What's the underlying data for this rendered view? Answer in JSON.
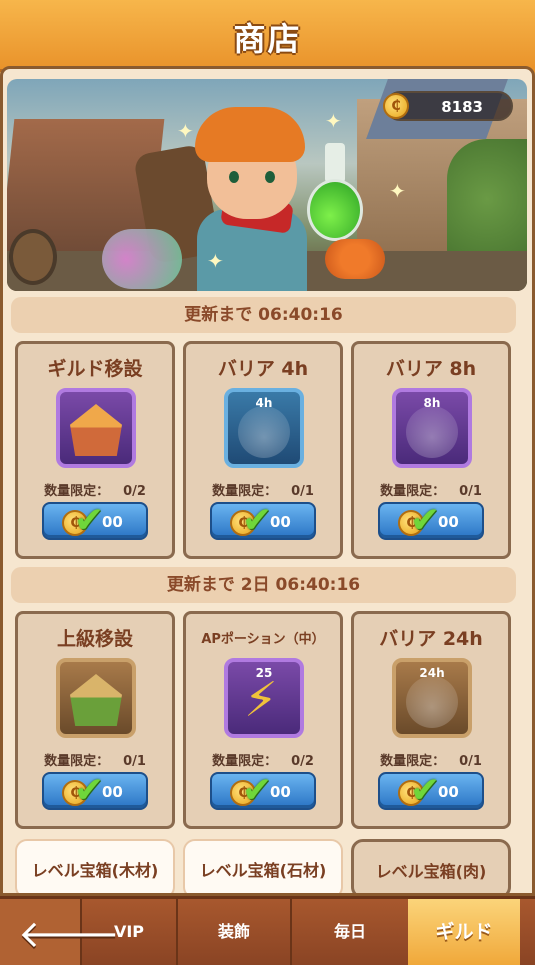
{
  "header": {
    "title": "商店"
  },
  "currency": {
    "icon": "coin-icon",
    "value": "8183"
  },
  "sections": [
    {
      "label": "更新まで 06:40:16"
    },
    {
      "label": "更新まで 2日 06:40:16"
    }
  ],
  "cards_row1": [
    {
      "title": "ギルド移設",
      "icon_label": "",
      "limit_label": "数量限定：",
      "limit_value": "0/2",
      "price": "00"
    },
    {
      "title": "バリア 4h",
      "icon_label": "4h",
      "limit_label": "数量限定：",
      "limit_value": "0/1",
      "price": "00"
    },
    {
      "title": "バリア 8h",
      "icon_label": "8h",
      "limit_label": "数量限定：",
      "limit_value": "0/1",
      "price": "00"
    }
  ],
  "cards_row2": [
    {
      "title": "上級移設",
      "icon_label": "",
      "limit_label": "数量限定：",
      "limit_value": "0/1",
      "price": "00"
    },
    {
      "title": "APポーション（中）",
      "icon_label": "25",
      "limit_label": "数量限定：",
      "limit_value": "0/2",
      "price": "00"
    },
    {
      "title": "バリア 24h",
      "icon_label": "24h",
      "limit_label": "数量限定：",
      "limit_value": "0/1",
      "price": "00"
    }
  ],
  "chests": [
    {
      "label": "レベル宝箱(木材)"
    },
    {
      "label": "レベル宝箱(石材)"
    },
    {
      "label": "レベル宝箱(肉)"
    }
  ],
  "nav": {
    "back_icon": "back-arrow-icon",
    "tabs": [
      {
        "label": "VIP"
      },
      {
        "label": "装飾"
      },
      {
        "label": "毎日"
      },
      {
        "label": "ギルド"
      }
    ]
  },
  "colors": {
    "accent": "#f0a83a",
    "button": "#2a74c4",
    "text_brown": "#7a3f22"
  }
}
